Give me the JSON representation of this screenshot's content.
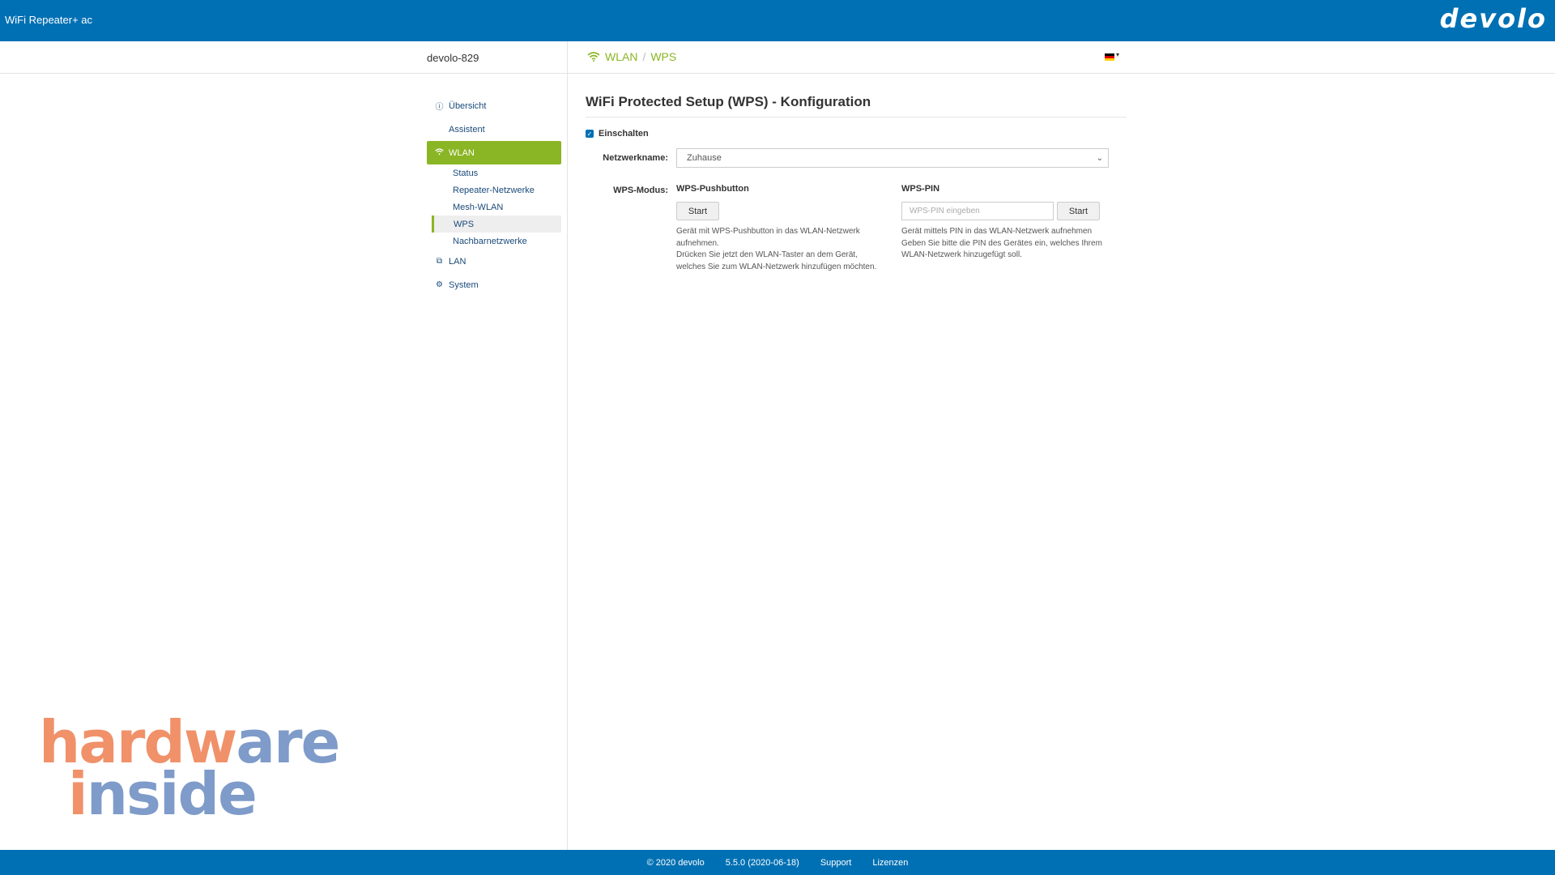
{
  "app": {
    "title": "WiFi Repeater+ ac",
    "logo": "devolo"
  },
  "subbar": {
    "device_name": "devolo-829",
    "breadcrumb": [
      "WLAN",
      "WPS"
    ],
    "language_flag": "de"
  },
  "sidebar": {
    "items": [
      {
        "label": "Übersicht",
        "icon": "info-icon"
      },
      {
        "label": "Assistent",
        "icon": ""
      },
      {
        "label": "WLAN",
        "icon": "wifi-icon",
        "active": true,
        "children": [
          "Status",
          "Repeater-Netzwerke",
          "Mesh-WLAN",
          "WPS",
          "Nachbarnetzwerke"
        ],
        "selected_child": "WPS"
      },
      {
        "label": "LAN",
        "icon": "network-icon"
      },
      {
        "label": "System",
        "icon": "wrench-icon"
      }
    ]
  },
  "main": {
    "title": "WiFi Protected Setup (WPS) - Konfiguration",
    "enable_label": "Einschalten",
    "enabled": true,
    "network_label": "Netzwerkname:",
    "network_value": "Zuhause",
    "wps_mode_label": "WPS-Modus:",
    "pushbutton": {
      "title": "WPS-Pushbutton",
      "button": "Start",
      "help": "Gerät mit WPS-Pushbutton in das WLAN-Netzwerk\naufnehmen.\nDrücken Sie jetzt den WLAN-Taster an dem Gerät,\nwelches Sie zum WLAN-Netzwerk hinzufügen möchten."
    },
    "pin": {
      "title": "WPS-PIN",
      "placeholder": "WPS-PIN eingeben",
      "button": "Start",
      "help": "Gerät mittels PIN in das WLAN-Netzwerk aufnehmen\nGeben Sie bitte die PIN des Gerätes ein, welches Ihrem\nWLAN-Netzwerk hinzugefügt soll."
    }
  },
  "watermark": {
    "line1_a": "hard",
    "line1_b": "w",
    "line1_c": "are",
    "line2_a": "i",
    "line2_b": "nside"
  },
  "footer": {
    "copyright": "© 2020   devolo",
    "version": "5.5.0 (2020-06-18)",
    "support": "Support",
    "licenses": "Lizenzen"
  },
  "colors": {
    "brand_blue": "#0070b4",
    "accent_green": "#8ab524"
  }
}
